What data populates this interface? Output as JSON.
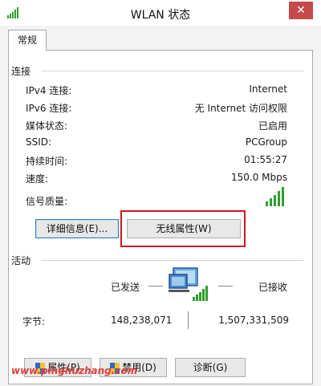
{
  "window": {
    "title": "WLAN 状态",
    "close_label": "✕"
  },
  "tabs": [
    {
      "label": "常规",
      "selected": true
    }
  ],
  "connection": {
    "section_title": "连接",
    "rows": [
      {
        "label": "IPv4 连接:",
        "value": "Internet"
      },
      {
        "label": "IPv6 连接:",
        "value": "无 Internet 访问权限"
      },
      {
        "label": "媒体状态:",
        "value": "已启用"
      },
      {
        "label": "SSID:",
        "value": "PCGroup"
      },
      {
        "label": "持续时间:",
        "value": "01:55:27"
      },
      {
        "label": "速度:",
        "value": "150.0 Mbps"
      }
    ],
    "signal_label": "信号质量:",
    "signal_bars": 5,
    "signal_level": 5,
    "details_button": "详细信息(E)...",
    "wireless_props_button": "无线属性(W)"
  },
  "activity": {
    "section_title": "活动",
    "sent_label": "已发送",
    "received_label": "已接收",
    "bytes_label": "字节:",
    "bytes_sent": "148,238,071",
    "bytes_received": "1,507,331,509"
  },
  "buttons": {
    "properties": "属性(P)",
    "disable": "禁用(D)",
    "diagnose": "诊断(G)"
  },
  "watermark": "www.pinghuzhang.com",
  "colors": {
    "signal_green": "#2f9e2f",
    "highlight_red": "#d0141c",
    "close_red": "#c64a4a"
  },
  "icons": [
    "wifi-signal-icon",
    "network-computer-icon",
    "shield-icon",
    "close-icon"
  ]
}
